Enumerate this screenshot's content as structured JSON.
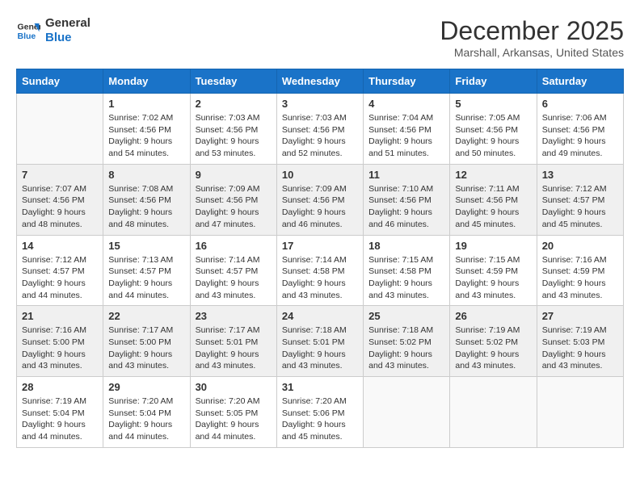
{
  "logo": {
    "line1": "General",
    "line2": "Blue"
  },
  "title": "December 2025",
  "subtitle": "Marshall, Arkansas, United States",
  "weekdays": [
    "Sunday",
    "Monday",
    "Tuesday",
    "Wednesday",
    "Thursday",
    "Friday",
    "Saturday"
  ],
  "weeks": [
    [
      {
        "day": "",
        "empty": true
      },
      {
        "day": "1",
        "sunrise": "Sunrise: 7:02 AM",
        "sunset": "Sunset: 4:56 PM",
        "daylight": "Daylight: 9 hours and 54 minutes."
      },
      {
        "day": "2",
        "sunrise": "Sunrise: 7:03 AM",
        "sunset": "Sunset: 4:56 PM",
        "daylight": "Daylight: 9 hours and 53 minutes."
      },
      {
        "day": "3",
        "sunrise": "Sunrise: 7:03 AM",
        "sunset": "Sunset: 4:56 PM",
        "daylight": "Daylight: 9 hours and 52 minutes."
      },
      {
        "day": "4",
        "sunrise": "Sunrise: 7:04 AM",
        "sunset": "Sunset: 4:56 PM",
        "daylight": "Daylight: 9 hours and 51 minutes."
      },
      {
        "day": "5",
        "sunrise": "Sunrise: 7:05 AM",
        "sunset": "Sunset: 4:56 PM",
        "daylight": "Daylight: 9 hours and 50 minutes."
      },
      {
        "day": "6",
        "sunrise": "Sunrise: 7:06 AM",
        "sunset": "Sunset: 4:56 PM",
        "daylight": "Daylight: 9 hours and 49 minutes."
      }
    ],
    [
      {
        "day": "7",
        "sunrise": "Sunrise: 7:07 AM",
        "sunset": "Sunset: 4:56 PM",
        "daylight": "Daylight: 9 hours and 48 minutes."
      },
      {
        "day": "8",
        "sunrise": "Sunrise: 7:08 AM",
        "sunset": "Sunset: 4:56 PM",
        "daylight": "Daylight: 9 hours and 48 minutes."
      },
      {
        "day": "9",
        "sunrise": "Sunrise: 7:09 AM",
        "sunset": "Sunset: 4:56 PM",
        "daylight": "Daylight: 9 hours and 47 minutes."
      },
      {
        "day": "10",
        "sunrise": "Sunrise: 7:09 AM",
        "sunset": "Sunset: 4:56 PM",
        "daylight": "Daylight: 9 hours and 46 minutes."
      },
      {
        "day": "11",
        "sunrise": "Sunrise: 7:10 AM",
        "sunset": "Sunset: 4:56 PM",
        "daylight": "Daylight: 9 hours and 46 minutes."
      },
      {
        "day": "12",
        "sunrise": "Sunrise: 7:11 AM",
        "sunset": "Sunset: 4:56 PM",
        "daylight": "Daylight: 9 hours and 45 minutes."
      },
      {
        "day": "13",
        "sunrise": "Sunrise: 7:12 AM",
        "sunset": "Sunset: 4:57 PM",
        "daylight": "Daylight: 9 hours and 45 minutes."
      }
    ],
    [
      {
        "day": "14",
        "sunrise": "Sunrise: 7:12 AM",
        "sunset": "Sunset: 4:57 PM",
        "daylight": "Daylight: 9 hours and 44 minutes."
      },
      {
        "day": "15",
        "sunrise": "Sunrise: 7:13 AM",
        "sunset": "Sunset: 4:57 PM",
        "daylight": "Daylight: 9 hours and 44 minutes."
      },
      {
        "day": "16",
        "sunrise": "Sunrise: 7:14 AM",
        "sunset": "Sunset: 4:57 PM",
        "daylight": "Daylight: 9 hours and 43 minutes."
      },
      {
        "day": "17",
        "sunrise": "Sunrise: 7:14 AM",
        "sunset": "Sunset: 4:58 PM",
        "daylight": "Daylight: 9 hours and 43 minutes."
      },
      {
        "day": "18",
        "sunrise": "Sunrise: 7:15 AM",
        "sunset": "Sunset: 4:58 PM",
        "daylight": "Daylight: 9 hours and 43 minutes."
      },
      {
        "day": "19",
        "sunrise": "Sunrise: 7:15 AM",
        "sunset": "Sunset: 4:59 PM",
        "daylight": "Daylight: 9 hours and 43 minutes."
      },
      {
        "day": "20",
        "sunrise": "Sunrise: 7:16 AM",
        "sunset": "Sunset: 4:59 PM",
        "daylight": "Daylight: 9 hours and 43 minutes."
      }
    ],
    [
      {
        "day": "21",
        "sunrise": "Sunrise: 7:16 AM",
        "sunset": "Sunset: 5:00 PM",
        "daylight": "Daylight: 9 hours and 43 minutes."
      },
      {
        "day": "22",
        "sunrise": "Sunrise: 7:17 AM",
        "sunset": "Sunset: 5:00 PM",
        "daylight": "Daylight: 9 hours and 43 minutes."
      },
      {
        "day": "23",
        "sunrise": "Sunrise: 7:17 AM",
        "sunset": "Sunset: 5:01 PM",
        "daylight": "Daylight: 9 hours and 43 minutes."
      },
      {
        "day": "24",
        "sunrise": "Sunrise: 7:18 AM",
        "sunset": "Sunset: 5:01 PM",
        "daylight": "Daylight: 9 hours and 43 minutes."
      },
      {
        "day": "25",
        "sunrise": "Sunrise: 7:18 AM",
        "sunset": "Sunset: 5:02 PM",
        "daylight": "Daylight: 9 hours and 43 minutes."
      },
      {
        "day": "26",
        "sunrise": "Sunrise: 7:19 AM",
        "sunset": "Sunset: 5:02 PM",
        "daylight": "Daylight: 9 hours and 43 minutes."
      },
      {
        "day": "27",
        "sunrise": "Sunrise: 7:19 AM",
        "sunset": "Sunset: 5:03 PM",
        "daylight": "Daylight: 9 hours and 43 minutes."
      }
    ],
    [
      {
        "day": "28",
        "sunrise": "Sunrise: 7:19 AM",
        "sunset": "Sunset: 5:04 PM",
        "daylight": "Daylight: 9 hours and 44 minutes."
      },
      {
        "day": "29",
        "sunrise": "Sunrise: 7:20 AM",
        "sunset": "Sunset: 5:04 PM",
        "daylight": "Daylight: 9 hours and 44 minutes."
      },
      {
        "day": "30",
        "sunrise": "Sunrise: 7:20 AM",
        "sunset": "Sunset: 5:05 PM",
        "daylight": "Daylight: 9 hours and 44 minutes."
      },
      {
        "day": "31",
        "sunrise": "Sunrise: 7:20 AM",
        "sunset": "Sunset: 5:06 PM",
        "daylight": "Daylight: 9 hours and 45 minutes."
      },
      {
        "day": "",
        "empty": true
      },
      {
        "day": "",
        "empty": true
      },
      {
        "day": "",
        "empty": true
      }
    ]
  ]
}
